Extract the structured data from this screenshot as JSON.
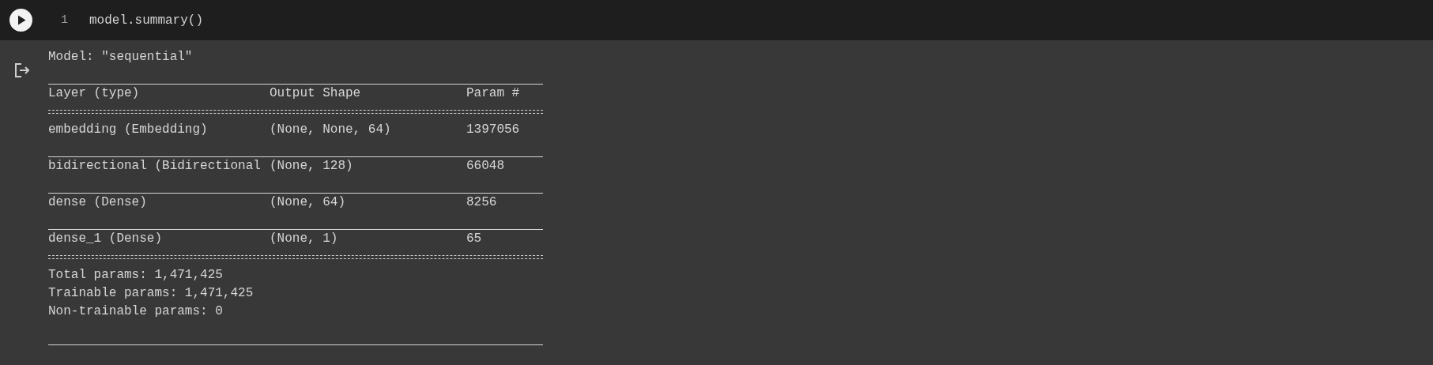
{
  "cell": {
    "line_number": "1",
    "code": "model.summary()"
  },
  "output": {
    "model_line": "Model: \"sequential\"",
    "columns": [
      "Layer (type)",
      "Output Shape",
      "Param #"
    ],
    "rows": [
      {
        "layer": "embedding (Embedding)",
        "output_shape": "(None, None, 64)",
        "params": "1397056"
      },
      {
        "layer": "bidirectional (Bidirectional",
        "output_shape": "(None, 128)",
        "params": "66048"
      },
      {
        "layer": "dense (Dense)",
        "output_shape": "(None, 64)",
        "params": "8256"
      },
      {
        "layer": "dense_1 (Dense)",
        "output_shape": "(None, 1)",
        "params": "65"
      }
    ],
    "totals": [
      "Total params: 1,471,425",
      "Trainable params: 1,471,425",
      "Non-trainable params: 0"
    ]
  }
}
